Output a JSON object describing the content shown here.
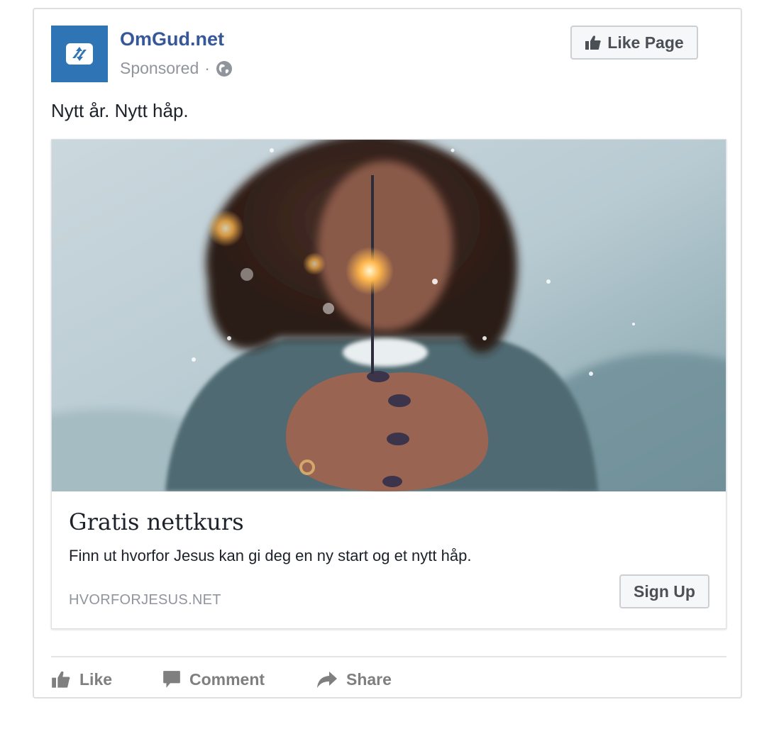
{
  "page": {
    "name": "OmGud.net",
    "sponsored": "Sponsored",
    "separator": "·",
    "like_page_label": "Like Page",
    "logo_color": "#2f74b5",
    "name_color": "#365899"
  },
  "post": {
    "text": "Nytt år. Nytt håp."
  },
  "ad": {
    "image_icon": "woman-holding-sparkler-photo",
    "headline": "Gratis nettkurs",
    "description": "Finn ut hvorfor Jesus kan gi deg en ny start og et nytt håp.",
    "domain": "HVORFORJESUS.NET",
    "cta_label": "Sign Up"
  },
  "actions": {
    "like": "Like",
    "comment": "Comment",
    "share": "Share"
  },
  "icons": {
    "logo": "omgud-logo-icon",
    "globe": "globe-icon",
    "thumbs_up": "thumbs-up-icon",
    "comment": "comment-icon",
    "share": "share-arrow-icon"
  }
}
